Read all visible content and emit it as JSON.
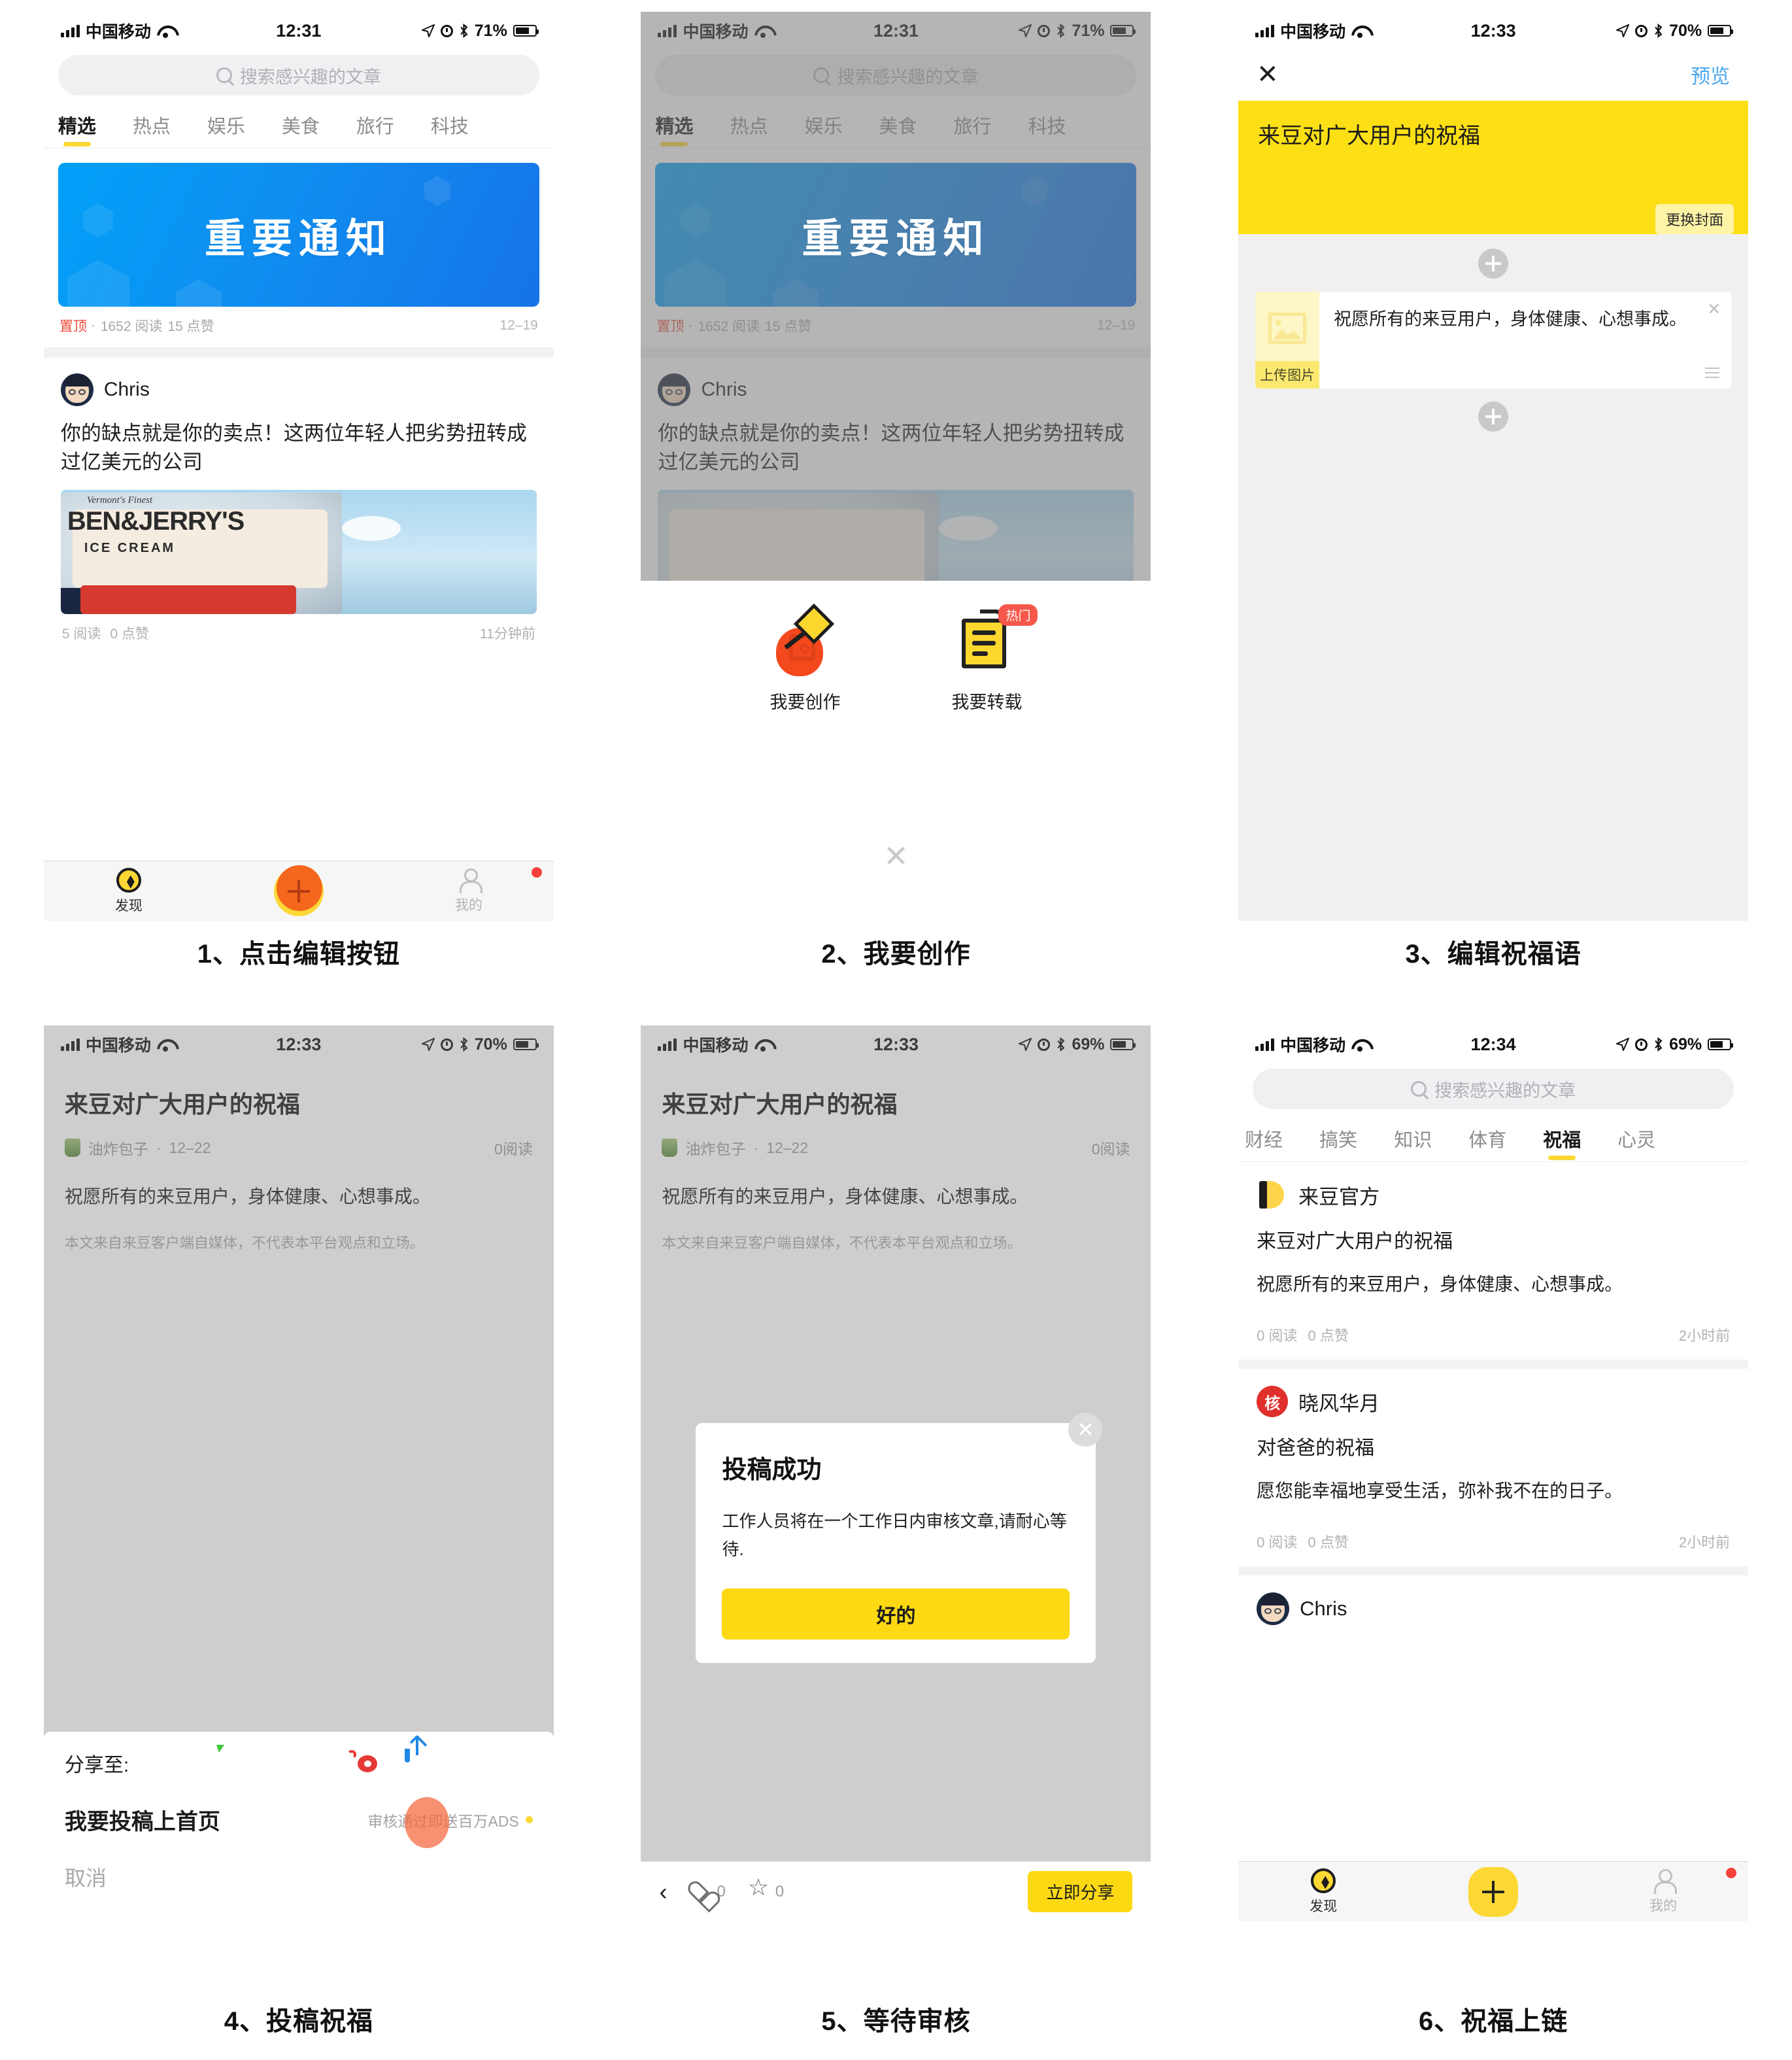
{
  "status_bar": {
    "carrier": "中国移动",
    "time_1": "12:31",
    "time_3": "12:33",
    "time_6": "12:34",
    "battery_71": "71%",
    "battery_70": "70%",
    "battery_69": "69%"
  },
  "search": {
    "placeholder": "搜索感兴趣的文章"
  },
  "home_tabs": [
    {
      "label": "精选",
      "active": true
    },
    {
      "label": "热点",
      "active": false
    },
    {
      "label": "娱乐",
      "active": false
    },
    {
      "label": "美食",
      "active": false
    },
    {
      "label": "旅行",
      "active": false
    },
    {
      "label": "科技",
      "active": false
    }
  ],
  "banner": {
    "text": "重要通知",
    "tag": "置顶",
    "separator": "·",
    "reads": "1652 阅读",
    "likes": "15 点赞",
    "date": "12–19"
  },
  "article": {
    "author": "Chris",
    "title": "你的缺点就是你的卖点！这两位年轻人把劣势扭转成过亿美元的公司",
    "thumb_top": "Vermont's Finest",
    "thumb_main": "BEN&JERRY'S",
    "thumb_sub": "ICE CREAM",
    "reads": "5 阅读",
    "likes": "0 点赞",
    "time": "11分钟前"
  },
  "bottom_nav": {
    "discover": "发现",
    "mine": "我的"
  },
  "action_sheet": {
    "create_label": "我要创作",
    "repost_label": "我要转载",
    "repost_badge": "热门",
    "close": "✕"
  },
  "editor": {
    "close": "✕",
    "preview": "预览",
    "cover_title": "来豆对广大用户的祝福",
    "change_cover": "更换封面",
    "block_text": "祝愿所有的来豆用户，身体健康、心想事成。",
    "upload_image": "上传图片",
    "block_close": "✕"
  },
  "article_view": {
    "title": "来豆对广大用户的祝福",
    "author": "油炸包子",
    "separator": "·",
    "date": "12–22",
    "reads": "0阅读",
    "text": "祝愿所有的来豆用户，身体健康、心想事成。",
    "disclaimer": "本文来自来豆客户端自媒体，不代表本平台观点和立场。"
  },
  "share_sheet": {
    "label": "分享至:",
    "icons": [
      "meipai-icon",
      "wechat-icon",
      "qq-icon",
      "qzone-icon",
      "weibo-icon",
      "export-icon"
    ],
    "submit_label": "我要投稿上首页",
    "hint": "审核通过即送百万ADS",
    "cancel": "取消"
  },
  "modal": {
    "title": "投稿成功",
    "text": "工作人员将在一个工作日内审核文章,请耐心等待.",
    "button": "好的",
    "close": "✕"
  },
  "article_bottom_bar": {
    "back": "‹",
    "likes": "0",
    "favs": "0",
    "share_now": "立即分享"
  },
  "feed_tabs": [
    {
      "label": "财经",
      "active": false
    },
    {
      "label": "搞笑",
      "active": false
    },
    {
      "label": "知识",
      "active": false
    },
    {
      "label": "体育",
      "active": false
    },
    {
      "label": "祝福",
      "active": true
    },
    {
      "label": "心灵",
      "active": false
    }
  ],
  "feed_items": [
    {
      "author": "来豆官方",
      "avatar": "laidou-logo-icon",
      "title": "来豆对广大用户的祝福",
      "text": "祝愿所有的来豆用户，身体健康、心想事成。",
      "reads": "0 阅读",
      "likes": "0 点赞",
      "time": "2小时前"
    },
    {
      "author": "晓风华月",
      "avatar": "he-badge-icon",
      "avatar_text": "核",
      "title": "对爸爸的祝福",
      "text": "愿您能幸福地享受生活，弥补我不在的日子。",
      "reads": "0 阅读",
      "likes": "0 点赞",
      "time": "2小时前"
    },
    {
      "author": "Chris",
      "avatar": "chris-avatar-icon",
      "title": "",
      "text": "",
      "reads": "",
      "likes": "",
      "time": ""
    }
  ],
  "captions": [
    "1、点击编辑按钮",
    "2、我要创作",
    "3、编辑祝福语",
    "4、投稿祝福",
    "5、等待审核",
    "6、祝福上链"
  ],
  "colors": {
    "brand_yellow": "#fcd913",
    "accent_orange": "#f4671c",
    "link_blue": "#4aa8f0",
    "badge_red": "#f5584a"
  }
}
